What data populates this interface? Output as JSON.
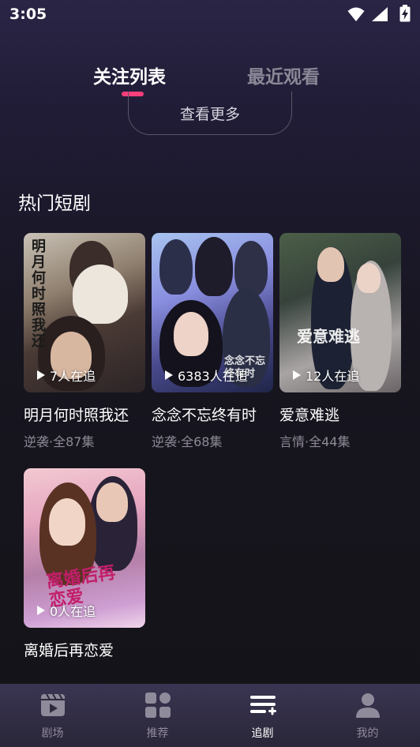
{
  "status_bar": {
    "time": "3:05"
  },
  "tabs": [
    {
      "label": "关注列表",
      "active": true
    },
    {
      "label": "最近观看",
      "active": false
    }
  ],
  "see_more_label": "查看更多",
  "section_title": "热门短剧",
  "dramas": [
    {
      "title": "明月何时照我还",
      "meta": "逆袭·全87集",
      "watching": "7人在追",
      "poster_text": "明月何时照我还"
    },
    {
      "title": "念念不忘终有时",
      "meta": "逆袭·全68集",
      "watching": "6383人在追",
      "poster_text": "念念不忘终有时"
    },
    {
      "title": "爱意难逃",
      "meta": "言情·全44集",
      "watching": "12人在追",
      "poster_text": "爱意难逃"
    },
    {
      "title": "离婚后再恋爱",
      "meta": "",
      "watching": "0人在追",
      "poster_text": "离婚后再恋爱"
    }
  ],
  "bottom_nav": [
    {
      "label": "剧场",
      "icon": "theater-icon",
      "active": false
    },
    {
      "label": "推荐",
      "icon": "grid-icon",
      "active": false
    },
    {
      "label": "追剧",
      "icon": "playlist-add-icon",
      "active": true
    },
    {
      "label": "我的",
      "icon": "person-icon",
      "active": false
    }
  ],
  "colors": {
    "accent": "#ff3f7b",
    "inactive": "#8a8796"
  }
}
